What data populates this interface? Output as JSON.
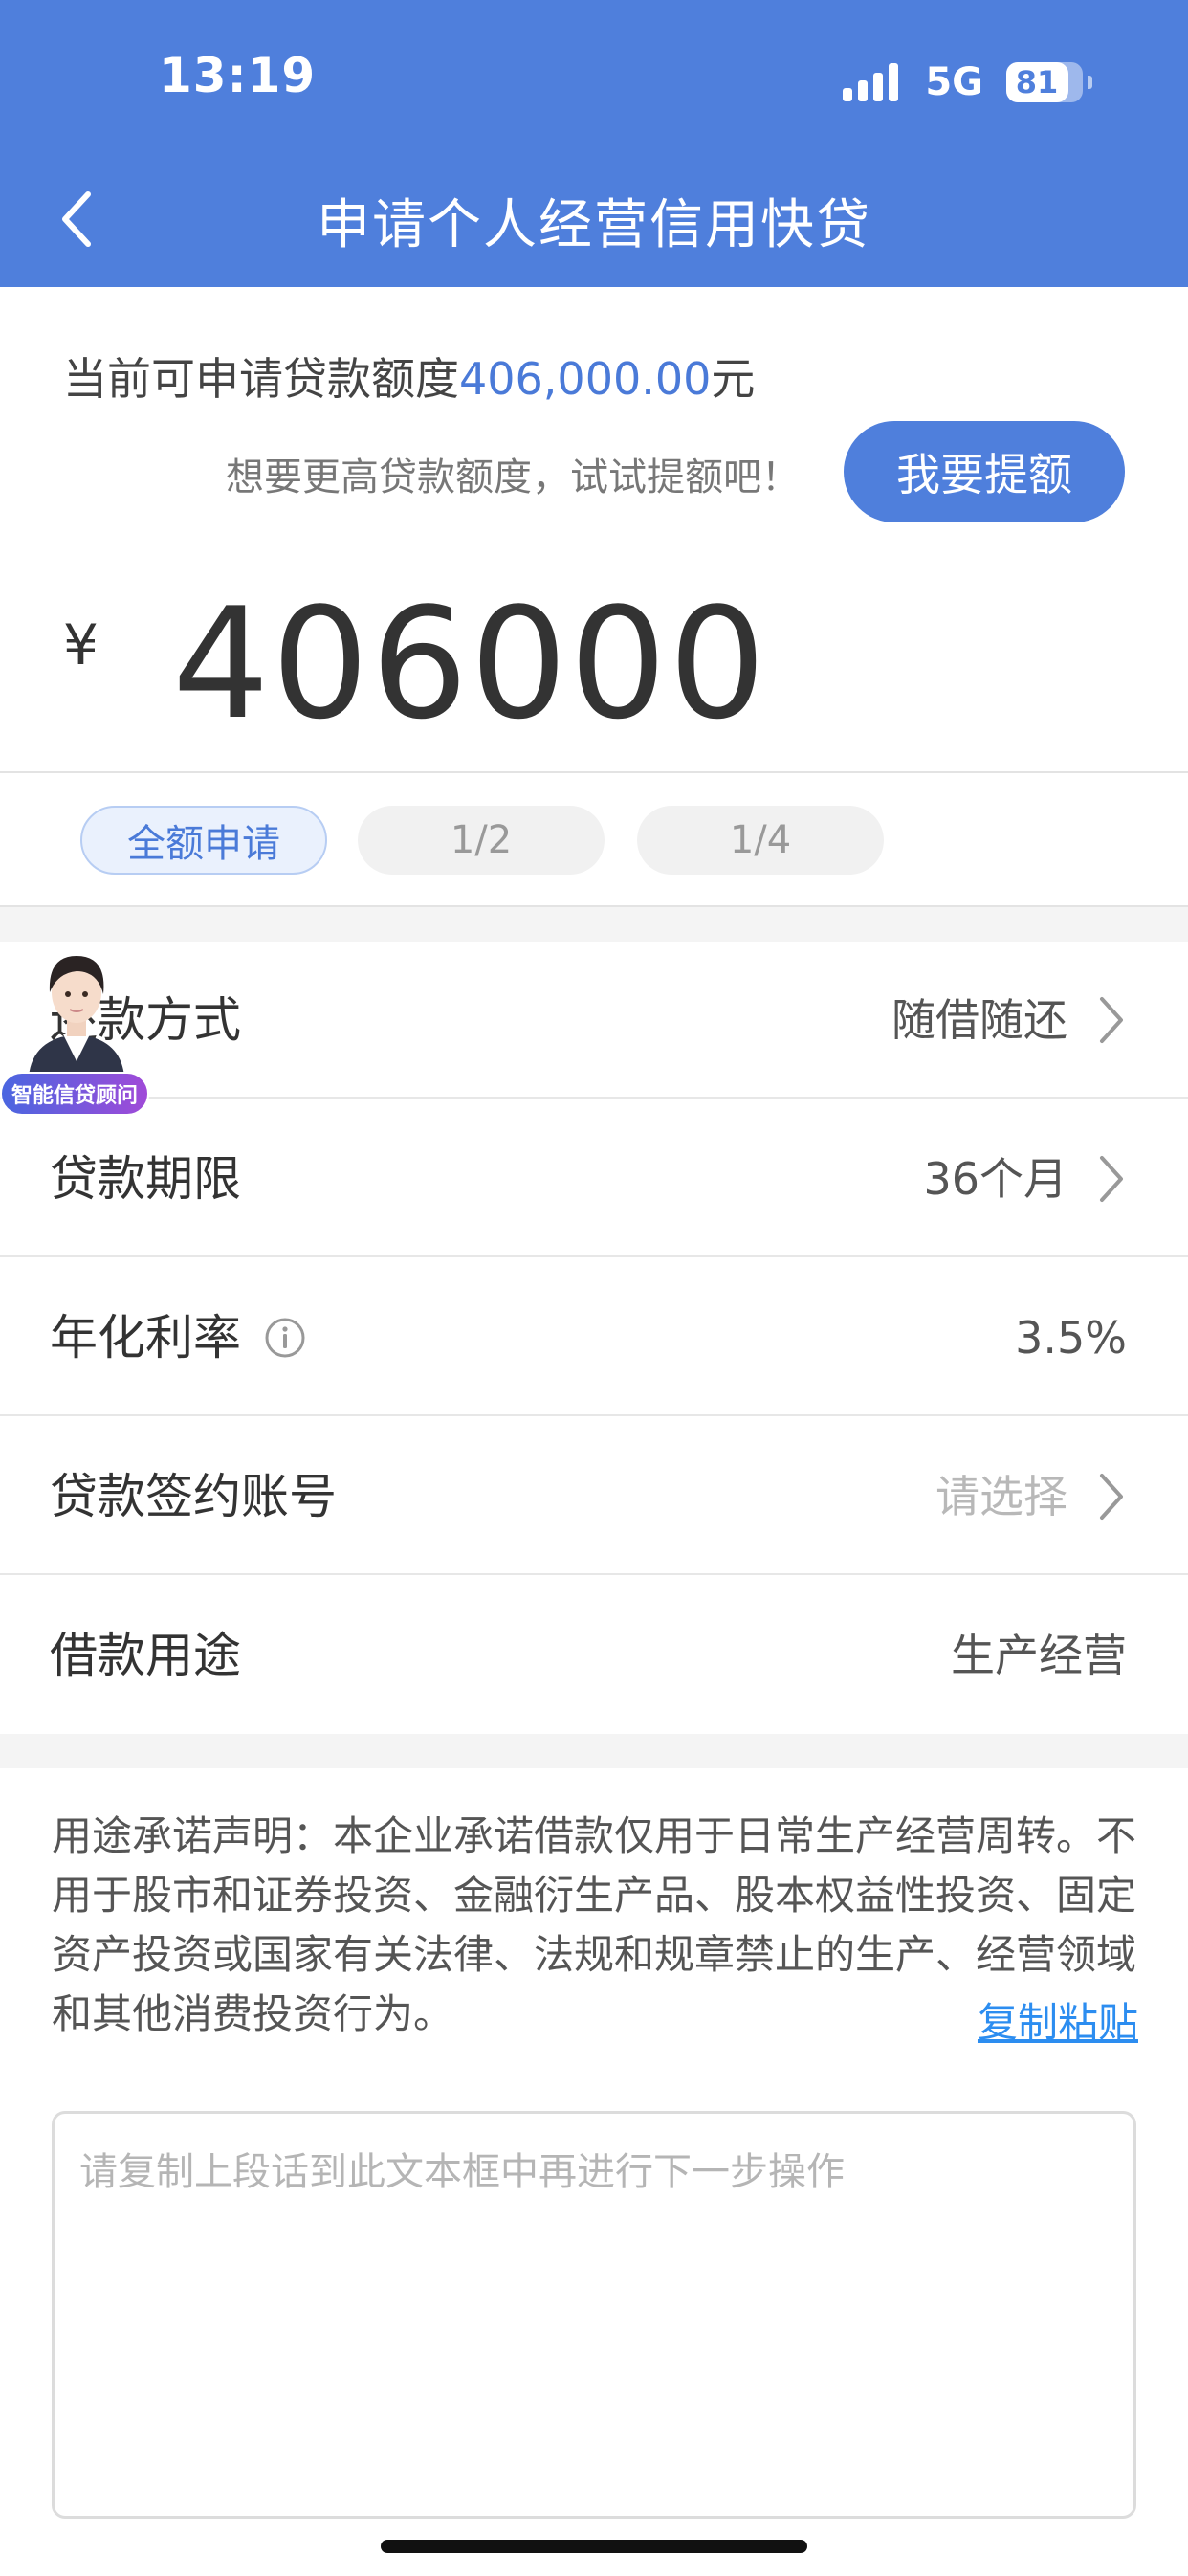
{
  "status_bar": {
    "time": "13:19",
    "network": "5G",
    "battery": "81"
  },
  "nav": {
    "title": "申请个人经营信用快贷",
    "back_icon": "chevron-left-icon"
  },
  "limit": {
    "prefix": "当前可申请贷款额度",
    "amount": "406,000.00",
    "suffix": "元",
    "tip": "想要更高贷款额度，试试提额吧！",
    "raise_button": "我要提额"
  },
  "loan_amount": {
    "currency": "¥",
    "value": "406000"
  },
  "chips": [
    "全额申请",
    "1/2",
    "1/4"
  ],
  "advisor": {
    "badge": "智能信贷顾问"
  },
  "rows": {
    "repay_method": {
      "label": "还款方式",
      "value": "随借随还"
    },
    "term": {
      "label": "贷款期限",
      "value": "36个月"
    },
    "rate": {
      "label": "年化利率",
      "value": "3.5%"
    },
    "account": {
      "label": "贷款签约账号",
      "value": "请选择"
    },
    "purpose": {
      "label": "借款用途",
      "value": "生产经营"
    }
  },
  "statement": {
    "text": "用途承诺声明：本企业承诺借款仅用于日常生产经营周转。不用于股市和证券投资、金融衍生产品、股本权益性投资、固定资产投资或国家有关法律、法规和规章禁止的生产、经营领域和其他消费投资行为。",
    "copy_link": "复制粘贴",
    "textarea_placeholder": "请复制上段话到此文本框中再进行下一步操作"
  },
  "colors": {
    "brand": "#4f7fdc",
    "amount_text": "#4a7ad8",
    "link": "#2c8df0"
  }
}
